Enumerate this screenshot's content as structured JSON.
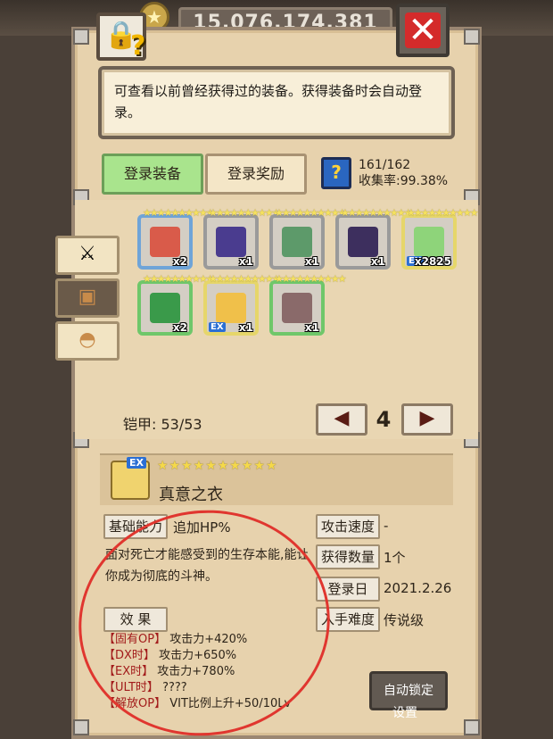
{
  "header": {
    "gold_amount": "15,076,174,381",
    "close_icon": "x-icon",
    "lock_icon": "lock-icon",
    "lock_help_glyph": "?"
  },
  "description": "可查看以前曾经获得过的装备。获得装备时会自动登录。",
  "tabs": [
    {
      "label": "登录装备",
      "active": true
    },
    {
      "label": "登录奖励",
      "active": false
    }
  ],
  "collection": {
    "count": "161/162",
    "rate_label": "收集率:",
    "rate_value": "99.38%"
  },
  "side_tabs": [
    {
      "icon": "sword-icon",
      "glyph": "⚔"
    },
    {
      "icon": "armor-icon",
      "glyph": "▣"
    },
    {
      "icon": "helmet-icon",
      "glyph": "◓"
    }
  ],
  "items": [
    {
      "stars": "★★★★★★★★★★",
      "count": "x2",
      "ex": false,
      "color": "#d95b4a",
      "frame": "#6fa4d8"
    },
    {
      "stars": "★★★★★★★★★★",
      "count": "x1",
      "ex": false,
      "color": "#4a3c8f",
      "frame": "#9a9a9a"
    },
    {
      "stars": "★★★★★★★★★★",
      "count": "x1",
      "ex": false,
      "color": "#5d9a6a",
      "frame": "#9a9a9a"
    },
    {
      "stars": "★★★★★★★★★★",
      "count": "x1",
      "ex": false,
      "color": "#3d2f5e",
      "frame": "#9a9a9a"
    },
    {
      "stars": "★★★★★★★★★★",
      "count": "x2825",
      "ex": true,
      "color": "#8ed47a",
      "frame": "#e6d66a"
    },
    {
      "stars": "★★★★★★★★★★",
      "count": "x2",
      "ex": false,
      "color": "#3a9a4a",
      "frame": "#6fc76a"
    },
    {
      "stars": "★★★★★★★★★★",
      "count": "x1",
      "ex": true,
      "color": "#f0c04a",
      "frame": "#e6d66a"
    },
    {
      "stars": "★★★★★★★★★★",
      "count": "x1",
      "ex": false,
      "color": "#8a6a6a",
      "frame": "#6fc76a"
    }
  ],
  "armor_count_label": "铠甲:",
  "armor_count_value": "53/53",
  "pagination": {
    "prev_glyph": "◀",
    "page": "4",
    "next_glyph": "▶"
  },
  "detail": {
    "ex_badge": "EX",
    "stars": "★★★★★★★★★★",
    "name": "真意之衣",
    "base_ability_label": "基础能力",
    "base_ability_value": "追加HP%",
    "story": "面对死亡才能感受到的生存本能,能让你成为彻底的斗神。",
    "effect_label": "效 果",
    "effects": [
      {
        "label": "【固有OP】",
        "value": "攻击力+420%"
      },
      {
        "label": "【DX时】",
        "value": "攻击力+650%"
      },
      {
        "label": "【EX时】",
        "value": "攻击力+780%"
      },
      {
        "label": "【ULT时】",
        "value": "????"
      },
      {
        "label": "【解放OP】",
        "value": "VIT比例上升+50/10Lv"
      }
    ],
    "attack_speed_label": "攻击速度",
    "attack_speed_value": "-",
    "obtained_label": "获得数量",
    "obtained_value": "1个",
    "register_date_label": "登录日",
    "register_date_value": "2021.2.26",
    "difficulty_label": "入手难度",
    "difficulty_value": "传说级"
  },
  "auto_lock_label": "自动锁定",
  "settings_label": "设置",
  "colors": {
    "panel": "#e7d2ad",
    "active_tab": "#a9e48d",
    "annotation_circle": "#e0362f"
  }
}
